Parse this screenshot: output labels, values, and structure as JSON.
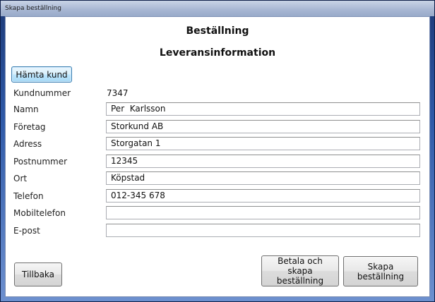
{
  "window": {
    "title": "Skapa beställning"
  },
  "headings": {
    "main": "Beställning",
    "section": "Leveransinformation"
  },
  "buttons": {
    "fetch_customer": "Hämta kund",
    "back": "Tillbaka",
    "pay_and_create": "Betala och skapa beställning",
    "create": "Skapa beställning"
  },
  "form": {
    "customer_number": {
      "label": "Kundnummer",
      "value": "7347"
    },
    "fields": [
      {
        "label": "Namn",
        "value": "Per  Karlsson"
      },
      {
        "label": "Företag",
        "value": "Storkund AB"
      },
      {
        "label": "Adress",
        "value": "Storgatan 1"
      },
      {
        "label": "Postnummer",
        "value": "12345"
      },
      {
        "label": "Ort",
        "value": "Köpstad"
      },
      {
        "label": "Telefon",
        "value": "012-345 678"
      },
      {
        "label": "Mobiltelefon",
        "value": ""
      },
      {
        "label": "E-post",
        "value": ""
      }
    ]
  }
}
